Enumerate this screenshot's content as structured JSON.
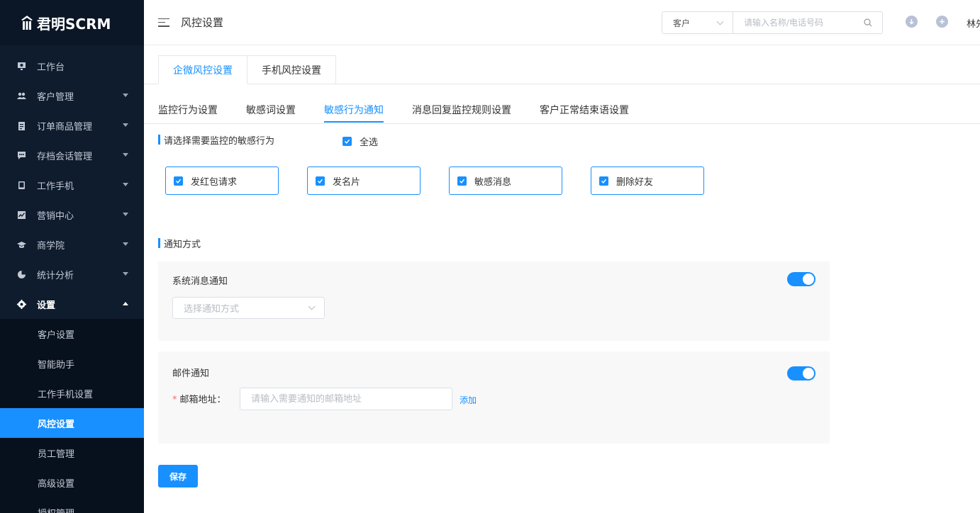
{
  "brand": {
    "name": "君明SCRM"
  },
  "sidebar": {
    "items": [
      {
        "label": "工作台",
        "icon": "monitor-icon",
        "has_caret": false
      },
      {
        "label": "客户管理",
        "icon": "users-icon",
        "has_caret": true
      },
      {
        "label": "订单商品管理",
        "icon": "clipboard-icon",
        "has_caret": true
      },
      {
        "label": "存档会话管理",
        "icon": "chat-icon",
        "has_caret": true
      },
      {
        "label": "工作手机",
        "icon": "phone-icon",
        "has_caret": true
      },
      {
        "label": "营销中心",
        "icon": "chart-icon",
        "has_caret": true
      },
      {
        "label": "商学院",
        "icon": "graduation-icon",
        "has_caret": true
      },
      {
        "label": "统计分析",
        "icon": "pie-icon",
        "has_caret": true
      },
      {
        "label": "设置",
        "icon": "gear-icon",
        "has_caret": true,
        "open": true
      }
    ],
    "sub_items": [
      {
        "label": "客户设置"
      },
      {
        "label": "智能助手"
      },
      {
        "label": "工作手机设置"
      },
      {
        "label": "风控设置",
        "active": true
      },
      {
        "label": "员工管理"
      },
      {
        "label": "高级设置"
      },
      {
        "label": "授权管理"
      }
    ]
  },
  "header": {
    "title": "风控设置",
    "search_type": "客户",
    "search_placeholder": "请输入名称/电话号码",
    "username": "林先"
  },
  "top_tabs": [
    {
      "label": "企微风控设置",
      "active": true
    },
    {
      "label": "手机风控设置",
      "active": false
    }
  ],
  "sub_tabs": [
    {
      "label": "监控行为设置",
      "active": false
    },
    {
      "label": "敏感词设置",
      "active": false
    },
    {
      "label": "敏感行为通知",
      "active": true
    },
    {
      "label": "消息回复监控规则设置",
      "active": false
    },
    {
      "label": "客户正常结束语设置",
      "active": false
    }
  ],
  "behavior_section": {
    "title": "请选择需要监控的敏感行为",
    "select_all_label": "全选",
    "select_all_checked": true,
    "options": [
      {
        "label": "发红包请求",
        "checked": true
      },
      {
        "label": "发名片",
        "checked": true
      },
      {
        "label": "敏感消息",
        "checked": true
      },
      {
        "label": "删除好友",
        "checked": true
      }
    ]
  },
  "notify_section": {
    "title": "通知方式",
    "system": {
      "label": "系统消息通知",
      "enabled": true,
      "select_placeholder": "选择通知方式"
    },
    "email": {
      "label": "邮件通知",
      "enabled": true,
      "field_label": "邮箱地址：",
      "required_mark": "*",
      "placeholder": "请输入需要通知的邮箱地址",
      "add_label": "添加"
    }
  },
  "save_label": "保存",
  "colors": {
    "primary": "#1890ff",
    "sidebar": "#0f1c2e",
    "active_item": "#1890ff"
  }
}
